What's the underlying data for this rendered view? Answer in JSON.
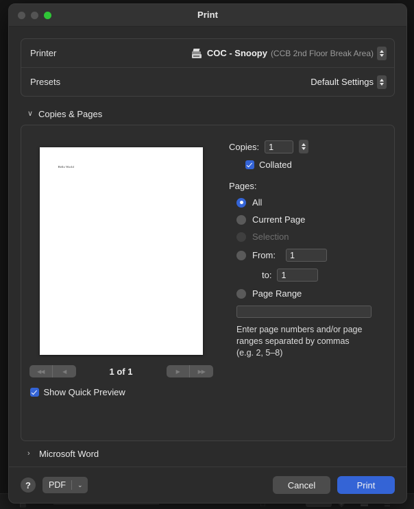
{
  "window": {
    "title": "Print",
    "traffic_lights": [
      "close-button",
      "minimize-button",
      "zoom-button"
    ]
  },
  "printer_row": {
    "label": "Printer",
    "icon": "printer-icon",
    "name": "COC - Snoopy",
    "location": "(CCB 2nd Floor Break Area)"
  },
  "presets_row": {
    "label": "Presets",
    "value": "Default Settings"
  },
  "section": {
    "chevron": "∨",
    "title": "Copies & Pages"
  },
  "preview": {
    "page_content": "Hello World",
    "pager_label": "1 of 1",
    "first_page_glyph": "◀◀",
    "prev_page_glyph": "◀",
    "next_page_glyph": "▶",
    "last_page_glyph": "▶▶",
    "quick_preview_label": "Show Quick Preview",
    "quick_preview_checked": true
  },
  "options": {
    "copies_label": "Copies:",
    "copies_value": "1",
    "collated_label": "Collated",
    "collated_checked": true,
    "pages_label": "Pages:",
    "radios": [
      {
        "label": "All",
        "selected": true,
        "disabled": false
      },
      {
        "label": "Current Page",
        "selected": false,
        "disabled": false
      },
      {
        "label": "Selection",
        "selected": false,
        "disabled": true
      },
      {
        "label": "From:",
        "selected": false,
        "disabled": false
      },
      {
        "label": "Page Range",
        "selected": false,
        "disabled": false
      }
    ],
    "from_value": "1",
    "to_label": "to:",
    "to_value": "1",
    "page_range_value": "",
    "page_range_placeholder": "",
    "hint": "Enter page numbers and/or page ranges separated by commas (e.g. 2, 5–8)"
  },
  "msword_section": {
    "chevron": "›",
    "title": "Microsoft Word"
  },
  "footer": {
    "help_label": "?",
    "pdf_label": "PDF",
    "pdf_caret": "⌄",
    "cancel_label": "Cancel",
    "print_label": "Print"
  },
  "colors": {
    "accent": "#3464d6",
    "window_bg": "#2b2b2b",
    "titlebar": "#333333",
    "panel_bg": "#2d2d2d",
    "zoom_light": "#2fc637",
    "inactive_light": "#545454",
    "text": "#e8e8e8",
    "muted_text": "#9b9b9b",
    "disabled_text": "#6f6f6f"
  }
}
